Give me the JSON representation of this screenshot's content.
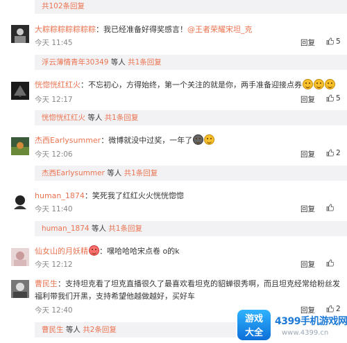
{
  "top_reply_bar": {
    "link": "共102条回复"
  },
  "comments": [
    {
      "user": "大粽粽粽粽粽粽粽",
      "text": "：我已经准备好得奖感言！",
      "mention": "@王者荣耀宋坦_克",
      "time": "今天 11:45",
      "reply_label": "回复",
      "likes": "5",
      "reply_bar": {
        "user": "浮云薄情青年30349",
        "etc": " 等人 ",
        "link": "共1条回复"
      }
    },
    {
      "user": "恍惚恍红红火",
      "text": "：不忘初心，方得始终，第一个关注的就是你，两手准备迎接点券",
      "time": "今天 12:17",
      "reply_label": "回复",
      "likes": "5",
      "reply_bar": {
        "user": "恍惚恍红红火",
        "etc": " 等人 ",
        "link": "共1条回复"
      }
    },
    {
      "user": "杰西Earlysummer",
      "text": "：微博就没中过奖，一年了",
      "time": "今天 12:06",
      "reply_label": "回复",
      "likes": "2",
      "reply_bar": {
        "user": "杰西Earlysummer",
        "etc": " 等人 ",
        "link": "共1条回复"
      }
    },
    {
      "user": "human_1874",
      "text": "：笑死我了红红火火恍恍惚惚",
      "time": "今天 11:40",
      "reply_label": "回复",
      "likes": "",
      "reply_bar": {
        "user": "human_1874",
        "etc": " 等人 ",
        "link": "共1条回复"
      }
    },
    {
      "user": "仙女山的月妖精",
      "text": "：嘿哈哈哈宋点卷 o的k",
      "time": "今天 12:12",
      "reply_label": "回复",
      "likes": "",
      "reply_bar": null
    },
    {
      "user": "曹民生",
      "text": "：支持坦克看了坦克直播很久了最喜欢看坦克的貂蝉很秀啊，而且坦克经常给粉丝发福利带我们开黑，支持希望他越做越好，买好车",
      "time": "今天 12:40",
      "reply_label": "回复",
      "likes": "2",
      "reply_bar": {
        "user": "曹民生",
        "etc": " 等人 ",
        "link": "共2条回复"
      }
    }
  ],
  "watermark": {
    "badge_line1": "游戏",
    "badge_line2": "大全",
    "main": "4399手机游戏网",
    "url": "www.4399.cn"
  },
  "colors": {
    "accent": "#eb7350",
    "reply_bg": "#f2f2f5",
    "meta": "#888888"
  }
}
